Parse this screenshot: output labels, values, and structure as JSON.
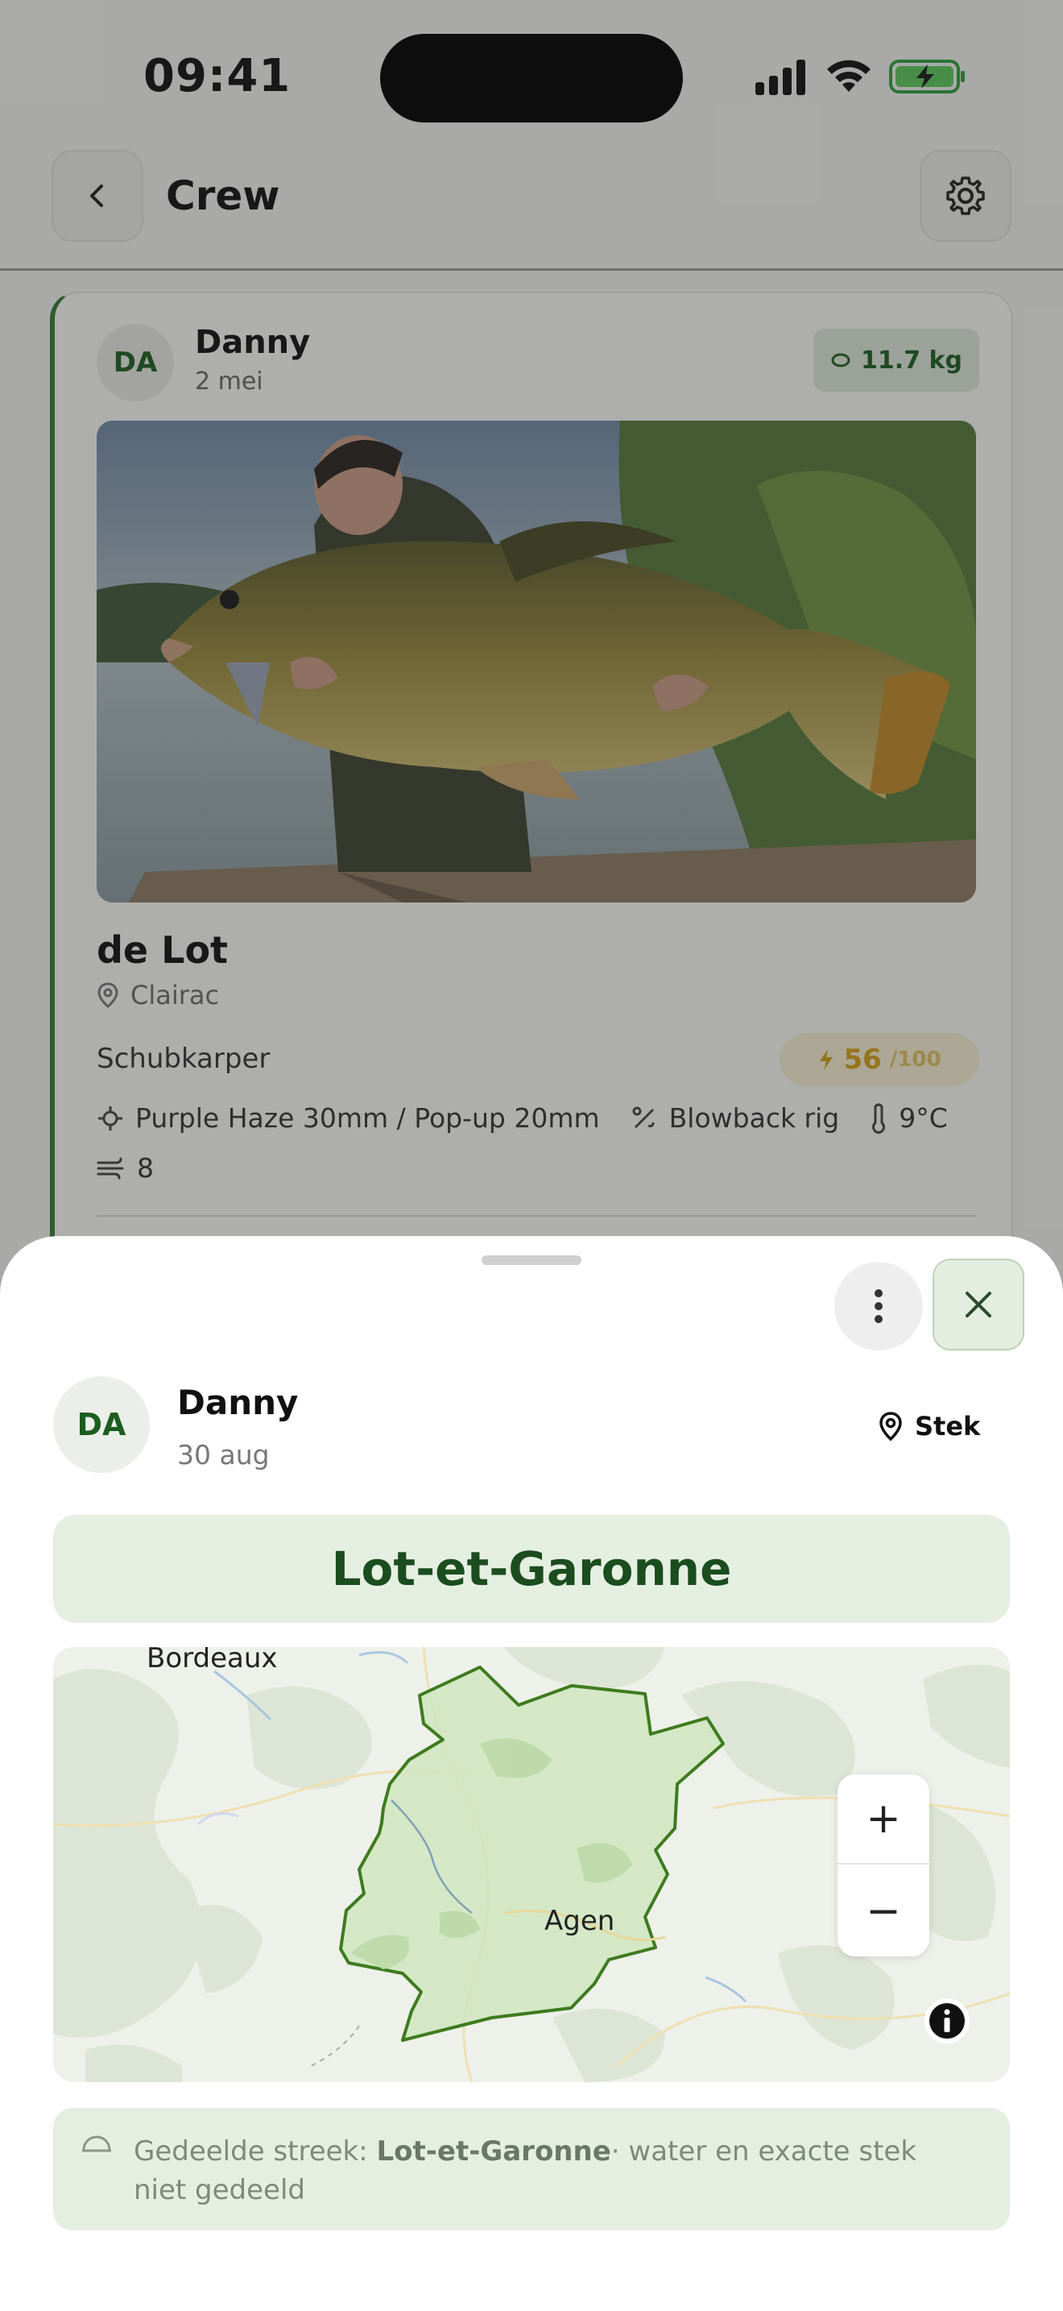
{
  "status_bar": {
    "time": "09:41"
  },
  "header": {
    "title": "Crew"
  },
  "card": {
    "avatar_initials": "DA",
    "user_name": "Danny",
    "date": "2 mei",
    "weight": "11.7 kg",
    "water_name": "de Lot",
    "location": "Clairac",
    "species": "Schubkarper",
    "score": "56",
    "score_max": "/100",
    "bait": "Purple Haze 30mm / Pop-up 20mm",
    "rig": "Blowback rig",
    "temperature": "9°C",
    "wind": "8"
  },
  "sheet": {
    "avatar_initials": "DA",
    "user_name": "Danny",
    "date": "30 aug",
    "stek_label": "Stek",
    "region_name": "Lot-et-Garonne",
    "map": {
      "city_bordeaux": "Bordeaux",
      "city_agen": "Agen",
      "zoom_in": "+",
      "zoom_out": "−",
      "region_fill": "#cfe6c0",
      "region_stroke": "#3e7b1e"
    },
    "note_prefix": "Gedeelde streek: ",
    "note_region": "Lot-et-Garonne",
    "note_suffix": "· water en exacte stek niet gedeeld"
  },
  "colors": {
    "accent": "#2e7d32",
    "accent_dark": "#1b4d1f",
    "tint": "#e5efe1",
    "score": "#d4a017"
  }
}
